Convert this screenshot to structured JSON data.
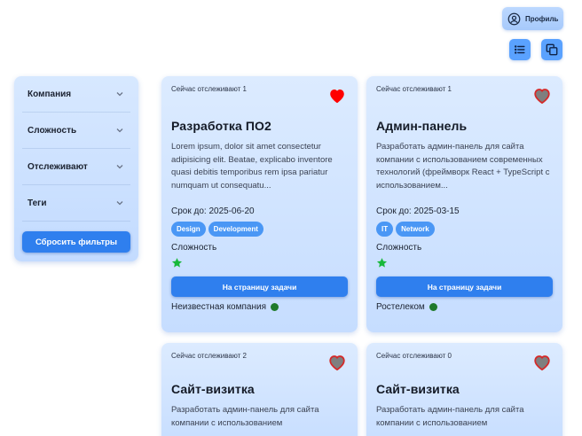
{
  "header": {
    "profile_label": "Профиль",
    "profile_icon": "user-circle-icon",
    "view_buttons": [
      {
        "name": "list-view",
        "icon": "list-icon"
      },
      {
        "name": "card-view",
        "icon": "copy-icon"
      }
    ]
  },
  "filters": {
    "items": [
      {
        "label": "Компания"
      },
      {
        "label": "Сложность"
      },
      {
        "label": "Отслеживают"
      },
      {
        "label": "Теги"
      }
    ],
    "reset_label": "Сбросить фильтры"
  },
  "colors": {
    "accent": "#2f7fee",
    "tag": "#4a97f5",
    "heart_active": "#ff0000",
    "heart_inactive": "#7f7f7f",
    "star": "#18b83a",
    "company_dot": "#1f7a2b"
  },
  "cards": [
    {
      "watching": "Сейчас отслеживают 1",
      "favorite": true,
      "title": "Разработка ПО2",
      "description": "Lorem ipsum, dolor sit amet consectetur adipisicing elit. Beatae, explicabo inventore quasi debitis temporibus rem ipsa pariatur numquam ut consequatu...",
      "deadline": "Срок до: 2025-06-20",
      "tags": [
        "Design",
        "Development"
      ],
      "difficulty_label": "Сложность",
      "difficulty_stars": 1,
      "button_label": "На страницу задачи",
      "company": "Неизвестная компания"
    },
    {
      "watching": "Сейчас отслеживают 1",
      "favorite": false,
      "title": "Админ-панель",
      "description": "Разработать админ-панель для сайта компании с использованием современных технологий (фреймворк React + TypeScript с использованием...",
      "deadline": "Срок до: 2025-03-15",
      "tags": [
        "IT",
        "Network"
      ],
      "difficulty_label": "Сложность",
      "difficulty_stars": 1,
      "button_label": "На страницу задачи",
      "company": "Ростелеком"
    },
    {
      "watching": "Сейчас отслеживают 2",
      "favorite": false,
      "title": "Сайт-визитка",
      "description": "Разработать админ-панель для сайта компании с использованием"
    },
    {
      "watching": "Сейчас отслеживают 0",
      "favorite": false,
      "title": "Сайт-визитка",
      "description": "Разработать админ-панель для сайта компании с использованием"
    }
  ]
}
